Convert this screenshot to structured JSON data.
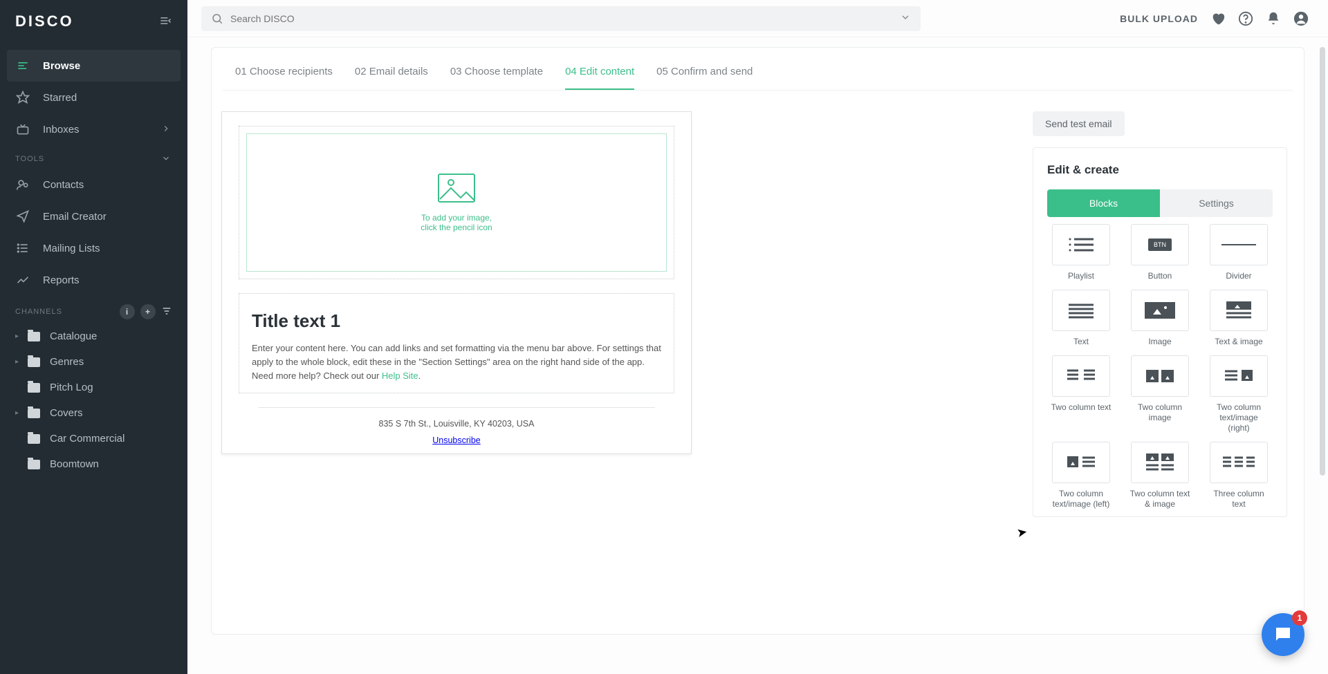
{
  "logo": "DISCO",
  "search": {
    "placeholder": "Search DISCO"
  },
  "topbar": {
    "bulk": "BULK UPLOAD"
  },
  "sidebar": {
    "items": [
      {
        "label": "Browse"
      },
      {
        "label": "Starred"
      },
      {
        "label": "Inboxes"
      }
    ],
    "tools_header": "TOOLS",
    "tools": [
      {
        "label": "Contacts"
      },
      {
        "label": "Email Creator"
      },
      {
        "label": "Mailing Lists"
      },
      {
        "label": "Reports"
      }
    ],
    "channels_header": "CHANNELS",
    "channels": [
      {
        "label": "Catalogue"
      },
      {
        "label": "Genres"
      },
      {
        "label": "Pitch Log"
      },
      {
        "label": "Covers"
      },
      {
        "label": "Car Commercial"
      },
      {
        "label": "Boomtown"
      }
    ]
  },
  "steps": [
    "01 Choose recipients",
    "02 Email details",
    "03 Choose template",
    "04 Edit content",
    "05 Confirm and send"
  ],
  "image_drop": {
    "line1": "To add your image,",
    "line2": "click the pencil icon"
  },
  "title_block": {
    "heading": "Title text 1",
    "body1": "Enter your content here. You can add links and set formatting via the menu bar above. For settings that apply to the whole block, edit these in the \"Section Settings\" area on the right hand side of the app.",
    "body2a": "Need more help? Check out our ",
    "help_link": "Help Site",
    "body2b": "."
  },
  "footer": {
    "address": "835 S 7th St., Louisville, KY 40203, USA",
    "unsub": "Unsubscribe"
  },
  "right": {
    "send_test": "Send test email",
    "panel_title": "Edit & create",
    "seg_blocks": "Blocks",
    "seg_settings": "Settings"
  },
  "blocks": [
    "Playlist",
    "Button",
    "Divider",
    "Text",
    "Image",
    "Text & image",
    "Two column text",
    "Two column image",
    "Two column text/image (right)",
    "Two column text/image (left)",
    "Two column text & image",
    "Three column text"
  ],
  "chat_badge": "1"
}
